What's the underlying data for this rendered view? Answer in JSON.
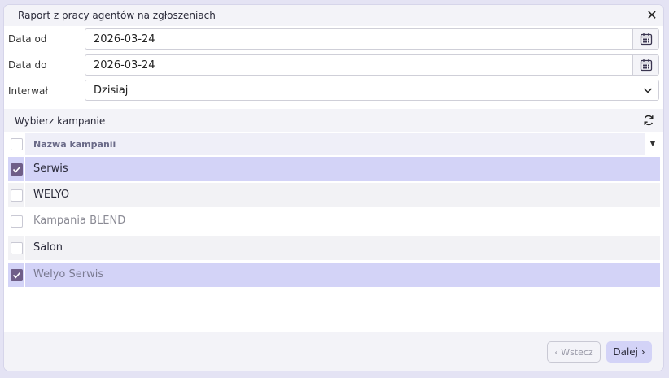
{
  "dialog": {
    "title": "Raport z pracy agentów na zgłoszeniach",
    "close_glyph": "✕"
  },
  "form": {
    "date_from": {
      "label": "Data od",
      "value": "2026-03-24",
      "icon": "calendar-icon"
    },
    "date_to": {
      "label": "Data do",
      "value": "2026-03-24",
      "icon": "calendar-icon"
    },
    "interval": {
      "label": "Interwał",
      "value": "Dzisiaj",
      "icon": "chevron-down-icon"
    }
  },
  "campaigns": {
    "section_label": "Wybierz kampanie",
    "column_header": "Nazwa kampanii",
    "sort_glyph": "▼",
    "rows": [
      {
        "name": "Serwis",
        "checked": true
      },
      {
        "name": "WELYO",
        "checked": false
      },
      {
        "name": "Kampania BLEND",
        "checked": false
      },
      {
        "name": "Salon",
        "checked": false
      },
      {
        "name": "Welyo Serwis",
        "checked": true
      }
    ]
  },
  "footer": {
    "back_label": "‹ Wstecz",
    "next_label": "Dalej ›"
  },
  "colors": {
    "accent": "#6f5e88",
    "selected_row": "#d3d3f7",
    "panel": "#f3f3f8"
  }
}
